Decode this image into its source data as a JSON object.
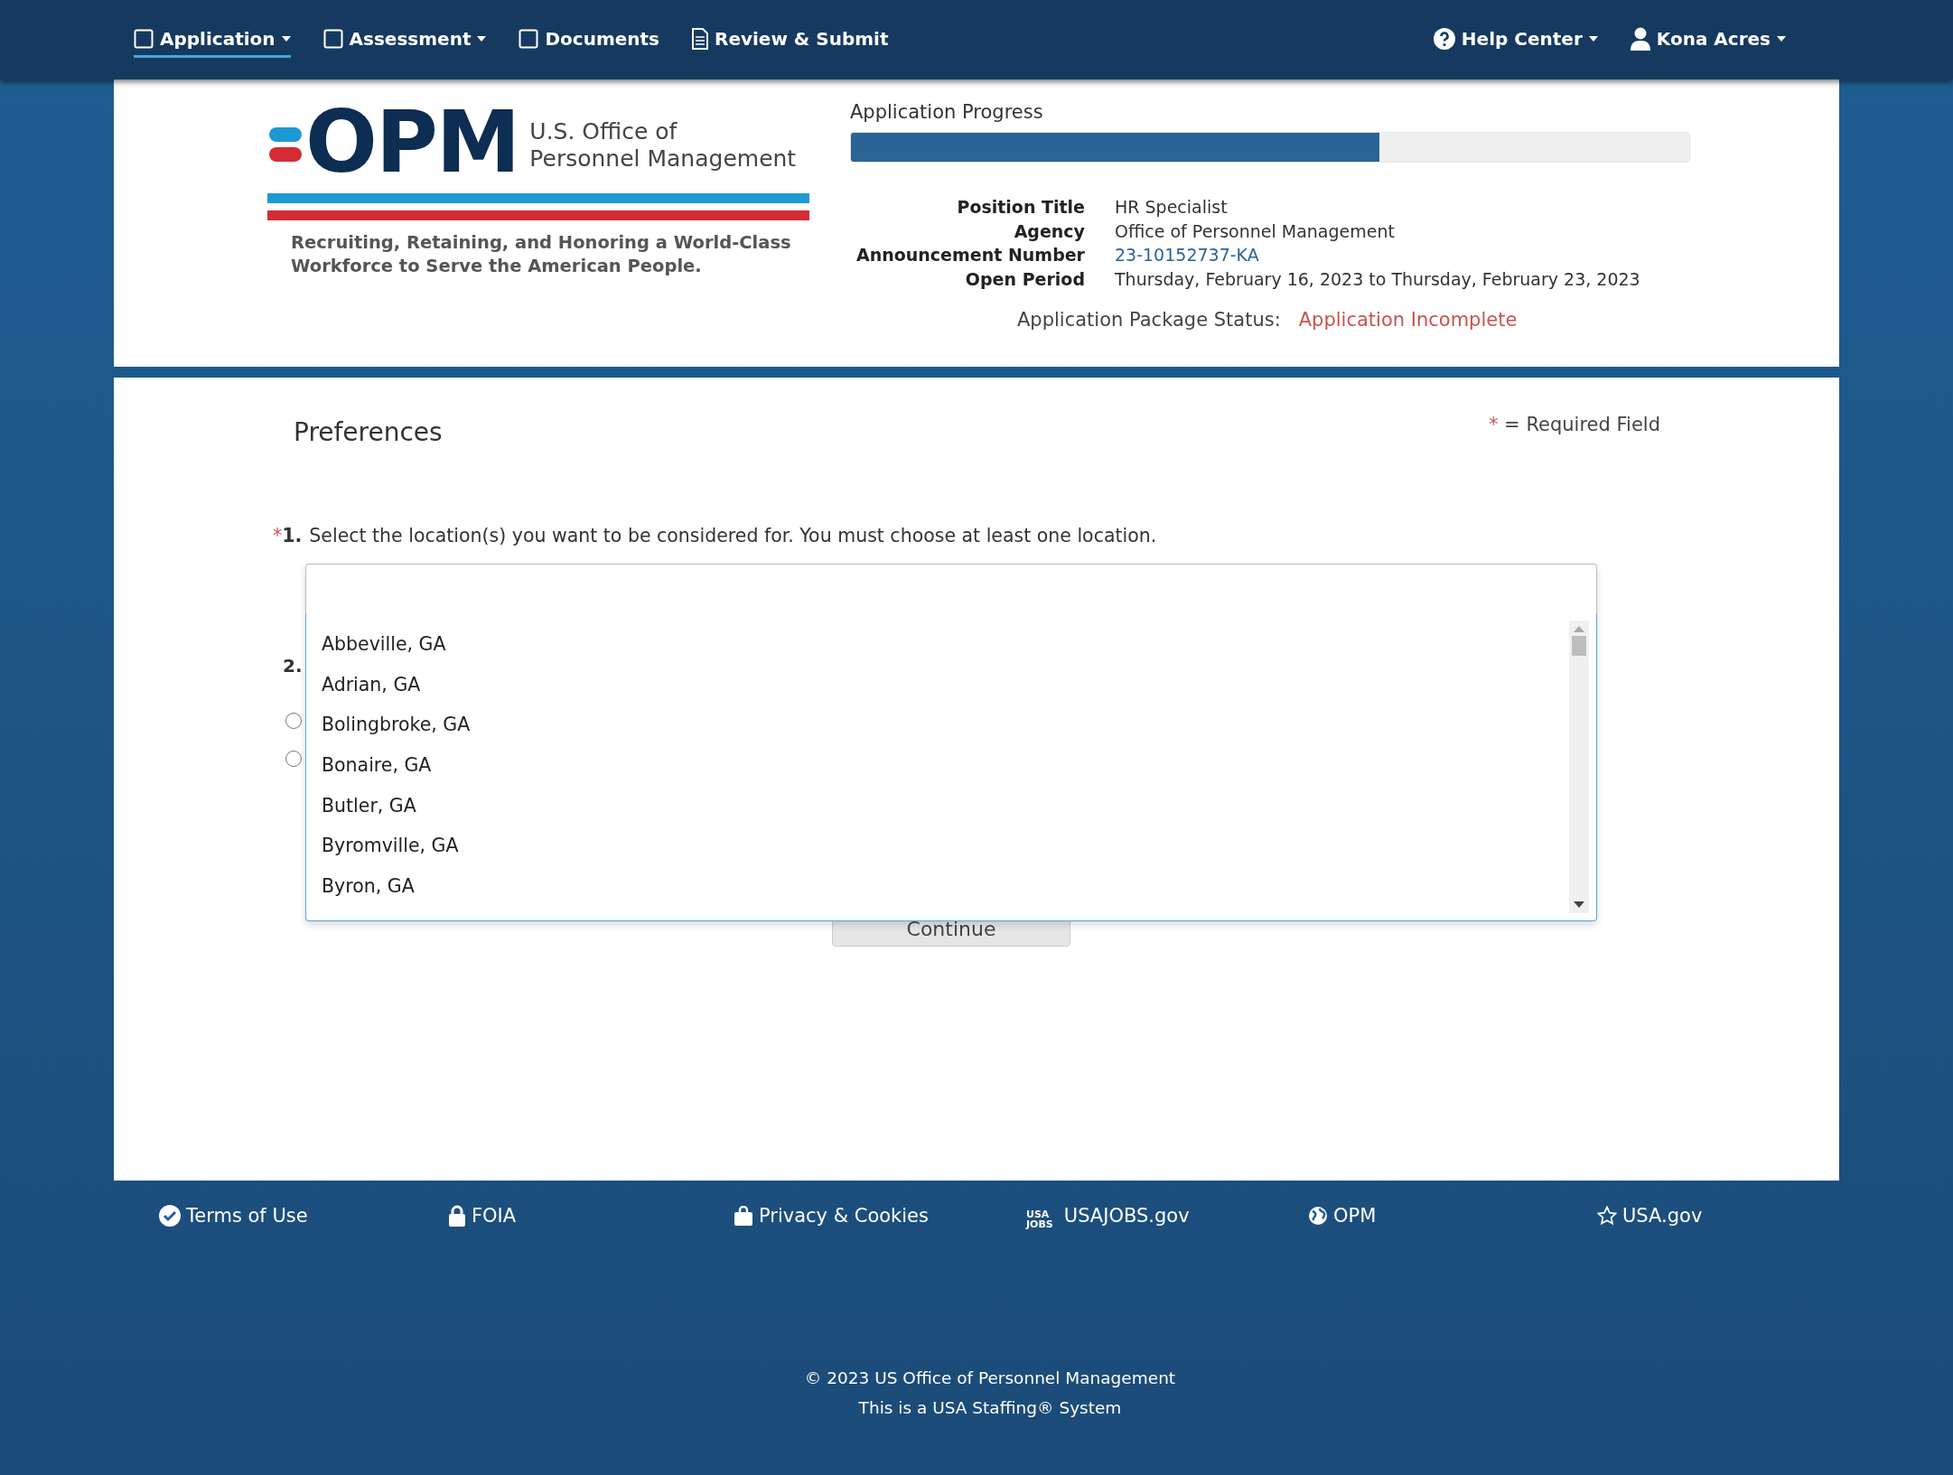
{
  "nav": {
    "left": [
      {
        "label": "Application",
        "kind": "status",
        "complete": false,
        "dropdown": true,
        "selected": true
      },
      {
        "label": "Assessment",
        "kind": "status",
        "complete": false,
        "dropdown": true,
        "selected": false
      },
      {
        "label": "Documents",
        "kind": "status",
        "complete": false,
        "dropdown": false,
        "selected": false
      },
      {
        "label": "Review & Submit",
        "kind": "document",
        "dropdown": false,
        "selected": false
      }
    ],
    "right": [
      {
        "label": "Help Center",
        "kind": "help",
        "dropdown": true
      },
      {
        "label": "Kona Acres",
        "kind": "user",
        "dropdown": true
      }
    ]
  },
  "header": {
    "logo": {
      "wordmark": "OPM",
      "agency_line1": "U.S. Office of",
      "agency_line2": "Personnel Management",
      "tagline": "Recruiting, Retaining, and Honoring a World-Class Workforce to Serve the American People."
    },
    "progress": {
      "label": "Application Progress",
      "level": 0.63
    },
    "details": [
      {
        "label": "Position Title",
        "value": "HR Specialist",
        "kind": "text"
      },
      {
        "label": "Agency",
        "value": "Office of Personnel Management",
        "kind": "text"
      },
      {
        "label": "Announcement Number",
        "value": "23-10152737-KA",
        "kind": "link"
      },
      {
        "label": "Open Period",
        "value": "Thursday, February 16, 2023 to Thursday, February 23, 2023",
        "kind": "text"
      }
    ],
    "status": {
      "label": "Application Package Status:",
      "value": "Application Incomplete"
    }
  },
  "form": {
    "title": "Preferences",
    "required_note": {
      "mark": "*",
      "text": "= Required Field"
    },
    "questions": [
      {
        "number": "1.",
        "required": true,
        "text": "Select the location(s) you want to be considered for. You must choose at least one location."
      },
      {
        "number": "2.",
        "required": false
      }
    ],
    "radios": [
      {
        "selected": false
      },
      {
        "selected": false
      }
    ],
    "location_list": {
      "items": [
        "Abbeville, GA",
        "Adrian, GA",
        "Bolingbroke, GA",
        "Bonaire, GA",
        "Butler, GA",
        "Byromville, GA",
        "Byron, GA"
      ]
    },
    "continue_button": "Continue"
  },
  "footer": {
    "links": [
      {
        "label": "Terms of Use",
        "kind": "check"
      },
      {
        "label": "FOIA",
        "kind": "lock"
      },
      {
        "label": "Privacy & Cookies",
        "kind": "bag"
      },
      {
        "label": "USAJOBS.gov",
        "kind": "usajobs",
        "badge": [
          "USA",
          "JOBS"
        ]
      },
      {
        "label": "OPM",
        "kind": "globe"
      },
      {
        "label": "USA.gov",
        "kind": "star"
      }
    ],
    "copyright": "© 2023 US Office of Personnel Management",
    "system_note": "This is a USA Staffing® System"
  }
}
